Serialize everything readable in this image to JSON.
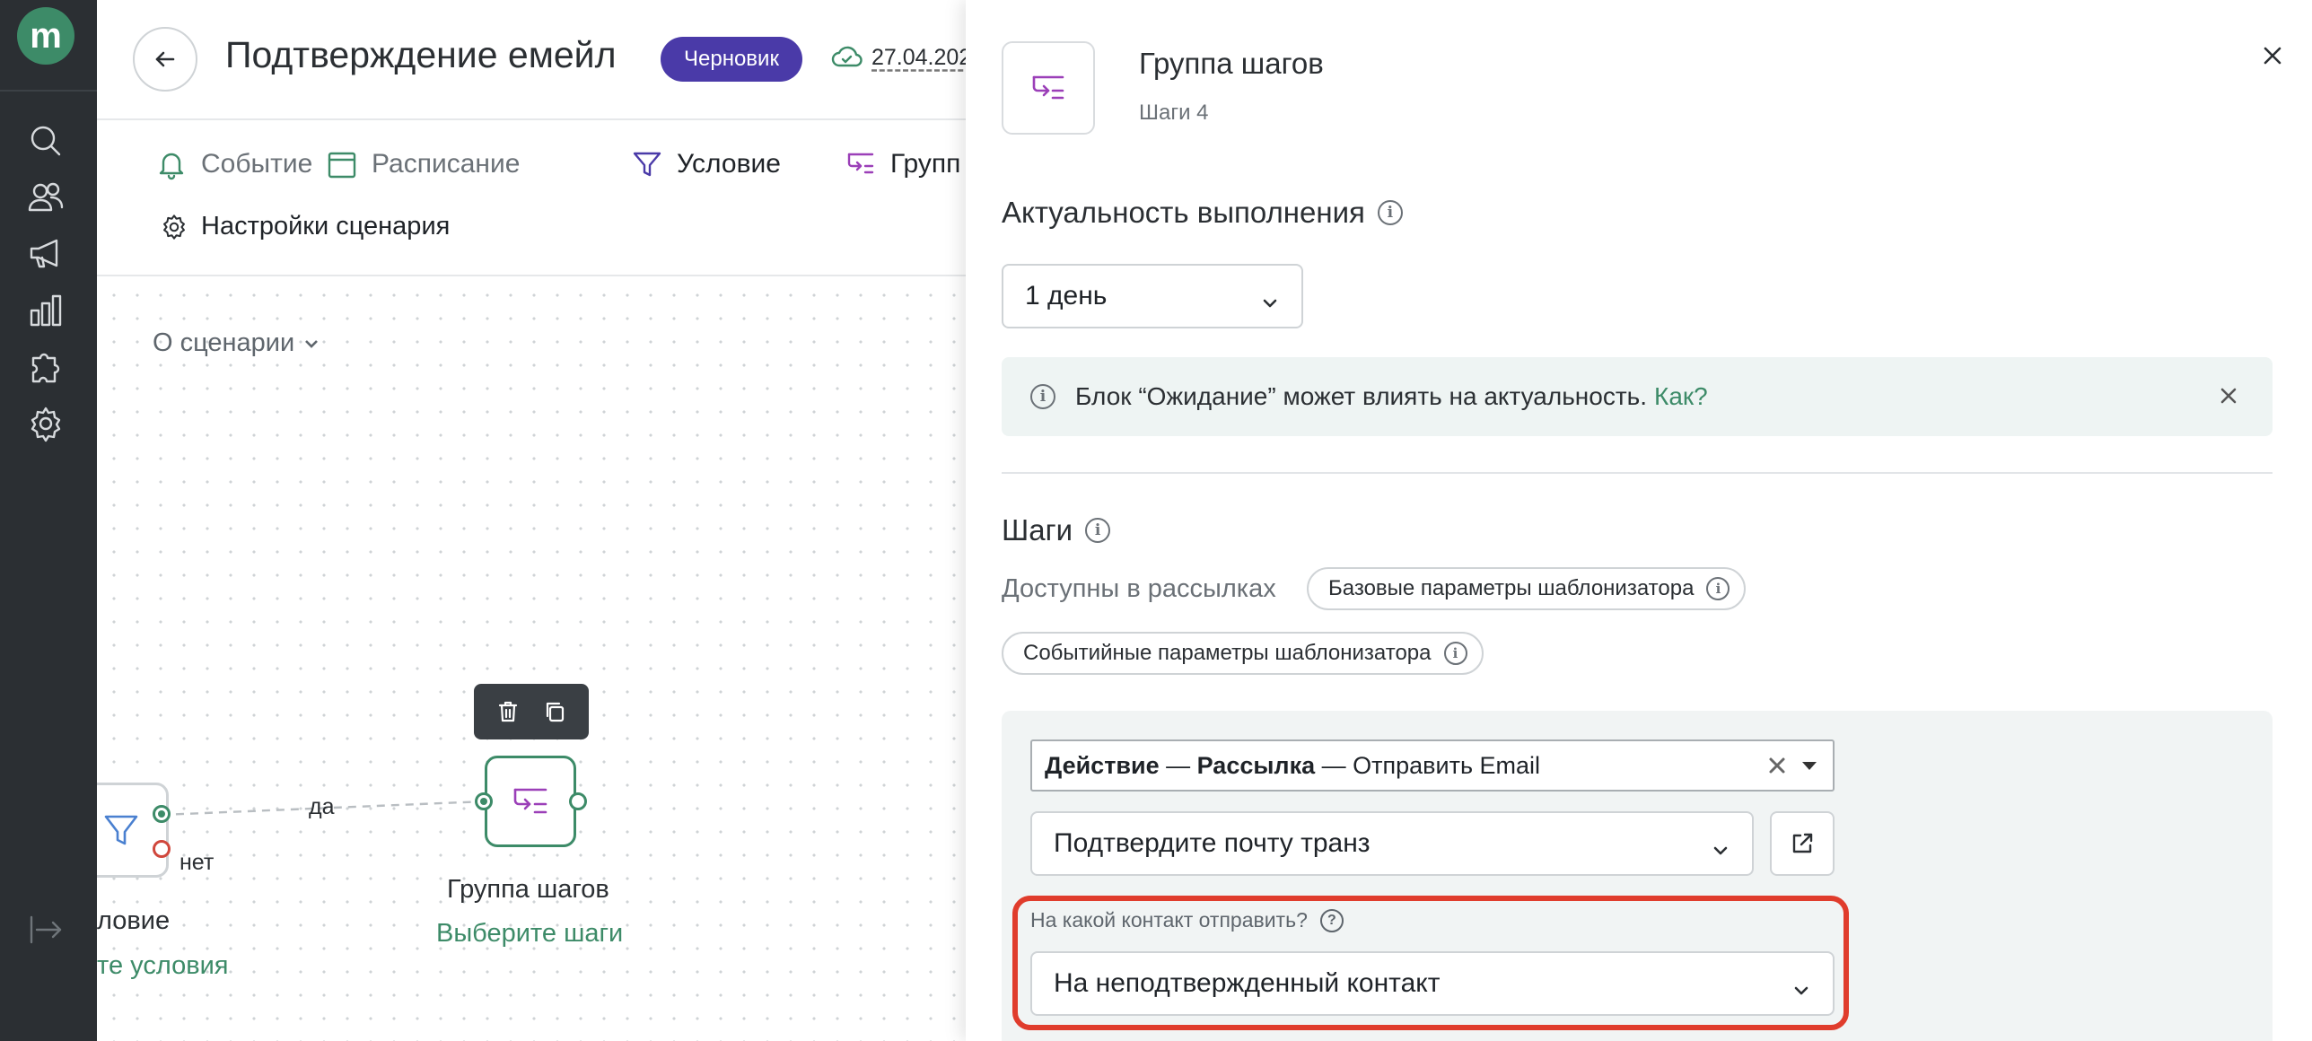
{
  "app": {
    "logo_letter": "m",
    "nav": [
      {
        "name": "search"
      },
      {
        "name": "contacts"
      },
      {
        "name": "campaigns"
      },
      {
        "name": "analytics"
      },
      {
        "name": "integrations"
      },
      {
        "name": "settings"
      },
      {
        "name": "collapse"
      }
    ]
  },
  "header": {
    "title": "Подтверждение емейл",
    "status_badge": "Черновик",
    "saved_date": "27.04.202"
  },
  "toolbar": {
    "event": "Событие",
    "schedule": "Расписание",
    "condition": "Условие",
    "group": "Групп",
    "scenario_settings": "Настройки сценария"
  },
  "canvas": {
    "about": "О сценарии",
    "edge_yes": "да",
    "edge_no": "нет",
    "condition_node": {
      "title": "ловие",
      "link": "те условия"
    },
    "group_node": {
      "title": "Группа шагов",
      "link": "Выберите шаги"
    }
  },
  "panel": {
    "title": "Группа шагов",
    "subtitle": "Шаги 4",
    "relevance_heading": "Актуальность выполнения",
    "relevance_value": "1 день",
    "notice_text": "Блок “Ожидание” может влиять на актуальность.",
    "notice_link": "Как?",
    "steps_heading": "Шаги",
    "available_label": "Доступны в рассылках",
    "chips": [
      "Базовые параметры шаблонизатора",
      "Событийные параметры шаблонизатора"
    ],
    "action": {
      "part1": "Действие",
      "sep1": " — ",
      "part2": "Рассылка",
      "sep2": " — ",
      "part3": "Отправить Email"
    },
    "template_value": "Подтвердите почту транз",
    "contact_label": "На какой контакт отправить?",
    "contact_value": "На неподтвержденный контакт"
  },
  "colors": {
    "accent_green": "#3d8b68",
    "badge_purple": "#4a3aa8",
    "highlight_red": "#e03c2c",
    "rail_dark": "#2b2f33"
  }
}
